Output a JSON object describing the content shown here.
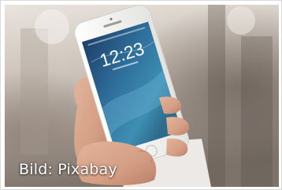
{
  "photo": {
    "caption": "Bild: Pixabay",
    "lock_screen": {
      "time": "12:23"
    }
  },
  "colors": {
    "background_top": "#e8e3dd",
    "background_bottom": "#7a6f68",
    "phone_body": "#f4f4f2",
    "screen_blue": "#2f6f9c",
    "skin": "#d9a58a",
    "caption_text": "#ffffff"
  }
}
